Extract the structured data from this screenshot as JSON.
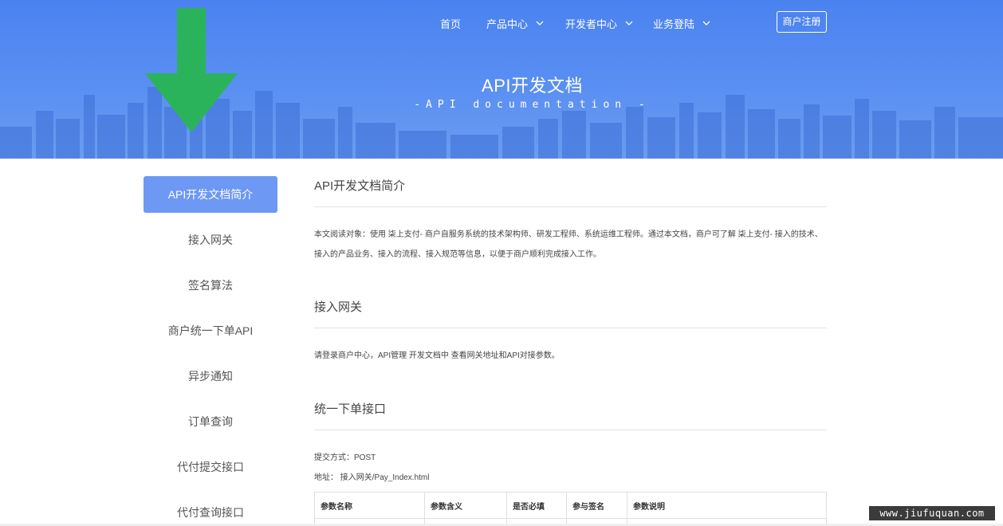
{
  "nav": {
    "items": [
      {
        "label": "首页",
        "has_dropdown": false
      },
      {
        "label": "产品中心",
        "has_dropdown": true
      },
      {
        "label": "开发者中心",
        "has_dropdown": true
      },
      {
        "label": "业务登陆",
        "has_dropdown": true
      }
    ],
    "register_label": "商户注册"
  },
  "hero": {
    "title": "API开发文档",
    "subtitle": "-API documentation -"
  },
  "sidebar": {
    "items": [
      {
        "label": "API开发文档简介",
        "active": true
      },
      {
        "label": "接入网关",
        "active": false
      },
      {
        "label": "签名算法",
        "active": false
      },
      {
        "label": "商户统一下单API",
        "active": false
      },
      {
        "label": "异步通知",
        "active": false
      },
      {
        "label": "订单查询",
        "active": false
      },
      {
        "label": "代付提交接口",
        "active": false
      },
      {
        "label": "代付查询接口",
        "active": false
      }
    ]
  },
  "main": {
    "sections": [
      {
        "title": "API开发文档简介",
        "text": "本文阅读对象：使用 柒上支付- 商户自服务系统的技术架构师、研发工程师、系统运维工程师。通过本文档，商户可了解 柒上支付- 接入的技术、接入的产品业务、接入的流程、接入规范等信息，以便于商户顺利完成接入工作。"
      },
      {
        "title": "接入网关",
        "text": "请登录商户中心，API管理 开发文档中 查看网关地址和API对接参数。"
      },
      {
        "title": "统一下单接口",
        "method": "提交方式：POST",
        "address": "地址： 接入网关/Pay_Index.html",
        "table_headers": [
          "参数名称",
          "参数含义",
          "是否必填",
          "参与签名",
          "参数说明"
        ]
      }
    ]
  },
  "watermark": "www.jiufuquan.com",
  "colors": {
    "hero_bg": "#4a82f0",
    "sidebar_active": "#6d98f4",
    "arrow": "#2bb35c"
  }
}
